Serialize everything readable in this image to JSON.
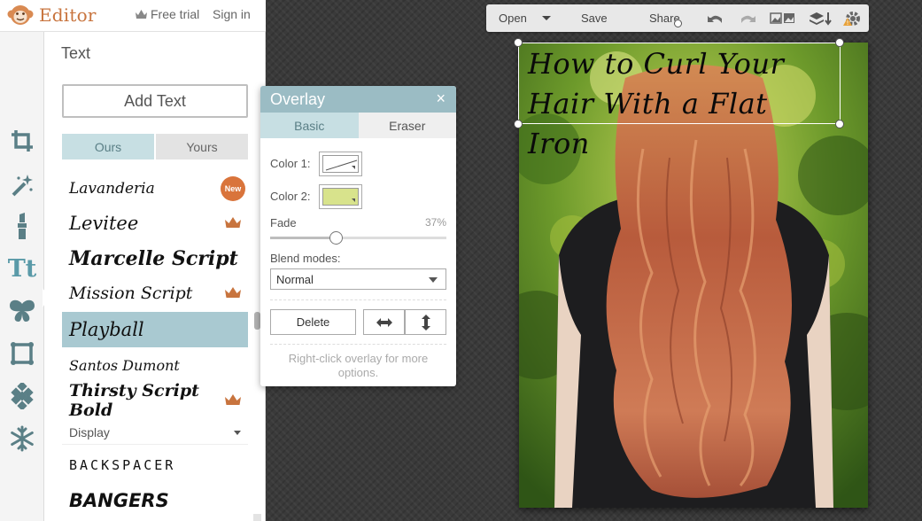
{
  "app": {
    "name": "Editor",
    "free_trial": "Free trial",
    "sign_in": "Sign in"
  },
  "toolbar": {
    "open": "Open",
    "save": "Save",
    "share": "Share"
  },
  "panel": {
    "title": "Text",
    "add_text": "Add Text",
    "tab_ours": "Ours",
    "tab_yours": "Yours",
    "fonts": [
      {
        "name": "Lavanderia",
        "badge": "New",
        "premium": false
      },
      {
        "name": "Levitee",
        "premium": true
      },
      {
        "name": "Marcelle Script",
        "premium": false
      },
      {
        "name": "Mission Script",
        "premium": true
      },
      {
        "name": "Playball",
        "premium": false,
        "selected": true
      },
      {
        "name": "Santos Dumont",
        "premium": false
      },
      {
        "name": "Thirsty Script Bold",
        "premium": true
      }
    ],
    "category": "Display",
    "display_fonts": [
      "BACKSPACER",
      "BANGERS"
    ]
  },
  "overlay": {
    "title": "Overlay",
    "close": "×",
    "tab_basic": "Basic",
    "tab_eraser": "Eraser",
    "color1_label": "Color 1:",
    "color2_label": "Color 2:",
    "color2_value": "#d8e38c",
    "fade_label": "Fade",
    "fade_value": "37%",
    "fade_fraction": 0.37,
    "blend_label": "Blend modes:",
    "blend_value": "Normal",
    "delete": "Delete",
    "hint": "Right-click overlay for more options."
  },
  "canvas": {
    "text": "How to Curl Your Hair With a Flat Iron"
  },
  "colors": {
    "accent": "#9bbcc4",
    "accent_light": "#c7dfe3",
    "brand": "#c8743e",
    "crown": "#c8743e"
  }
}
